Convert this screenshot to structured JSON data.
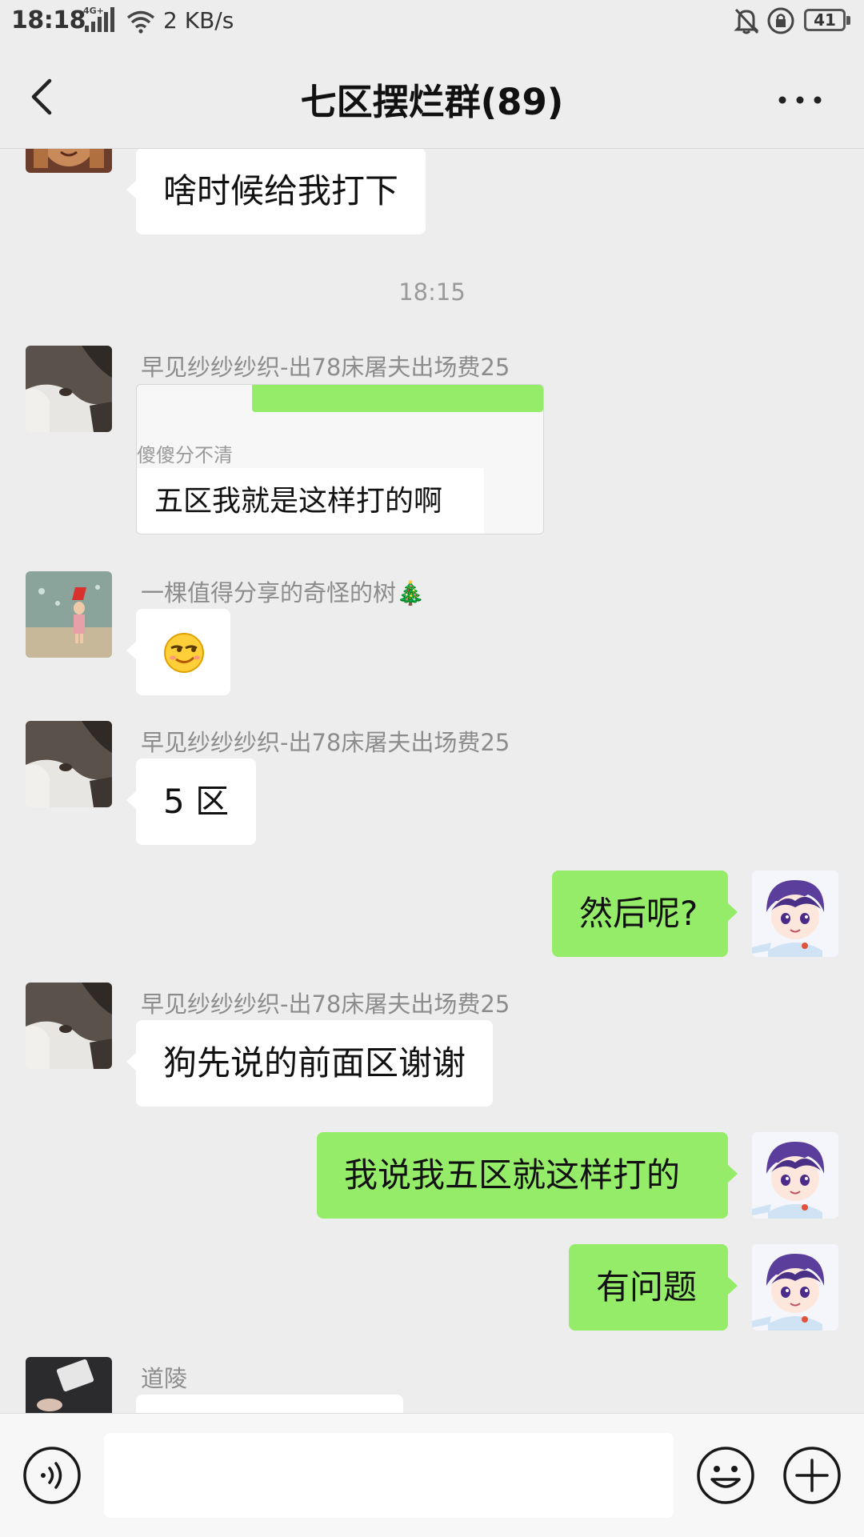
{
  "status_bar": {
    "time": "18:18",
    "network": "4G+",
    "speed": "2 KB/s",
    "battery": "41"
  },
  "header": {
    "title": "七区摆烂群(89)"
  },
  "messages": [
    {
      "direction": "in",
      "text": "啥时候给我打下"
    },
    {
      "type": "timestamp",
      "text": "18:15"
    },
    {
      "direction": "in",
      "sender": "早见纱纱纱织-出78床屠夫出场费25",
      "type": "image",
      "image": {
        "quoted_sender": "傻傻分不清",
        "quoted_text": "五区我就是这样打的啊"
      }
    },
    {
      "direction": "in",
      "sender": "一棵值得分享的奇怪的树🎄",
      "type": "emoji",
      "emoji": "smirk-emoji"
    },
    {
      "direction": "in",
      "sender": "早见纱纱纱织-出78床屠夫出场费25",
      "text": "5 区"
    },
    {
      "direction": "out",
      "text": "然后呢?"
    },
    {
      "direction": "in",
      "sender": "早见纱纱纱织-出78床屠夫出场费25",
      "text": "狗先说的前面区谢谢"
    },
    {
      "direction": "out",
      "text": "我说我五区就这样打的"
    },
    {
      "direction": "out",
      "text": "有问题"
    },
    {
      "direction": "in",
      "sender": "道陵",
      "text": ""
    }
  ],
  "input_bar": {
    "placeholder": "",
    "icons": [
      "voice-icon",
      "emoji-icon",
      "plus-icon"
    ]
  },
  "colors": {
    "background": "#ededed",
    "outgoing_bubble": "#95ec69",
    "incoming_bubble": "#ffffff"
  }
}
